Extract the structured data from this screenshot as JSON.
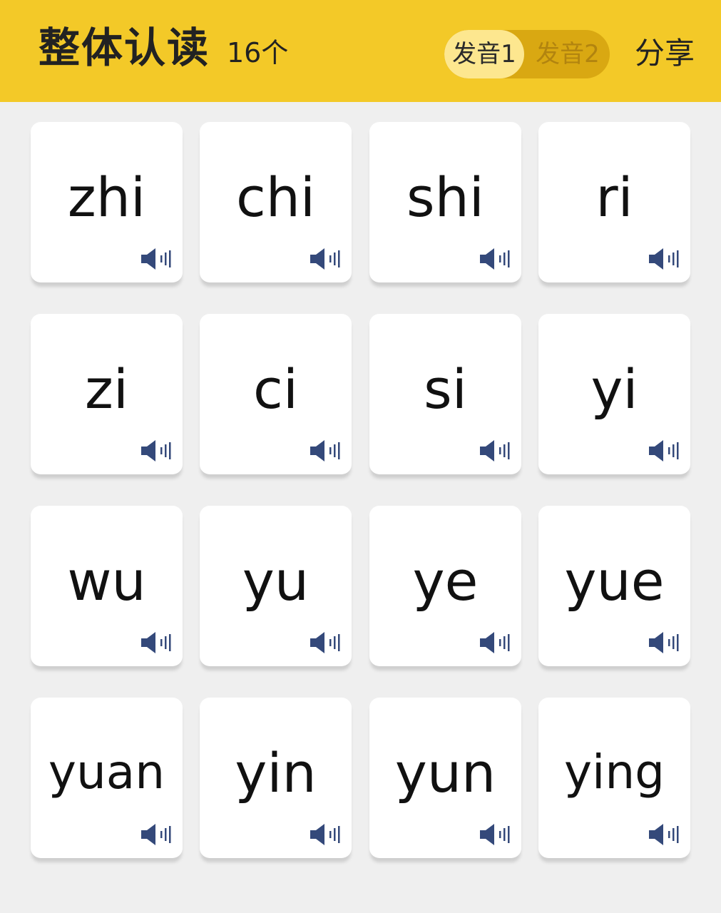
{
  "header": {
    "title": "整体认读",
    "count": "16个",
    "voice_options": [
      "发音1",
      "发音2"
    ],
    "selected_voice": "发音1",
    "share_label": "分享",
    "background_color": "#f3c928"
  },
  "cards": [
    {
      "syllable": "zhi",
      "icon": "speaker-icon"
    },
    {
      "syllable": "chi",
      "icon": "speaker-icon"
    },
    {
      "syllable": "shi",
      "icon": "speaker-icon"
    },
    {
      "syllable": "ri",
      "icon": "speaker-icon"
    },
    {
      "syllable": "zi",
      "icon": "speaker-icon"
    },
    {
      "syllable": "ci",
      "icon": "speaker-icon"
    },
    {
      "syllable": "si",
      "icon": "speaker-icon"
    },
    {
      "syllable": "yi",
      "icon": "speaker-icon"
    },
    {
      "syllable": "wu",
      "icon": "speaker-icon"
    },
    {
      "syllable": "yu",
      "icon": "speaker-icon"
    },
    {
      "syllable": "ye",
      "icon": "speaker-icon"
    },
    {
      "syllable": "yue",
      "icon": "speaker-icon"
    },
    {
      "syllable": "yuan",
      "icon": "speaker-icon"
    },
    {
      "syllable": "yin",
      "icon": "speaker-icon"
    },
    {
      "syllable": "yun",
      "icon": "speaker-icon"
    },
    {
      "syllable": "ying",
      "icon": "speaker-icon"
    }
  ],
  "colors": {
    "speaker_icon": "#34497a",
    "page_background": "#efefef",
    "card_background": "#ffffff"
  }
}
